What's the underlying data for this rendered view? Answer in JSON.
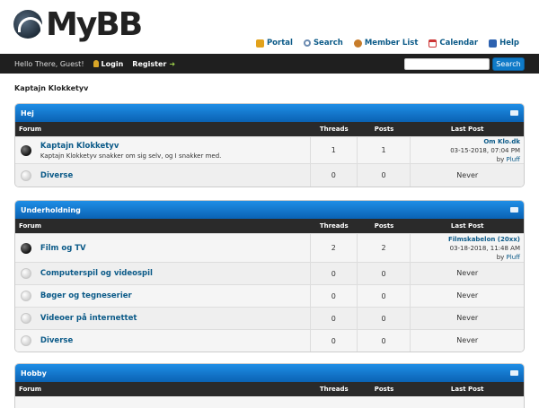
{
  "header": {
    "logo_text": "MyBB",
    "links": [
      {
        "label": "Portal",
        "icon": "portal-icon"
      },
      {
        "label": "Search",
        "icon": "search-icon"
      },
      {
        "label": "Member List",
        "icon": "members-icon"
      },
      {
        "label": "Calendar",
        "icon": "calendar-icon"
      },
      {
        "label": "Help",
        "icon": "help-icon"
      }
    ]
  },
  "panel": {
    "welcome": "Hello There, Guest!",
    "login": "Login",
    "register": "Register",
    "search_button": "Search"
  },
  "breadcrumb": "Kaptajn Klokketyv",
  "columns": {
    "forum": "Forum",
    "threads": "Threads",
    "posts": "Posts",
    "last_post": "Last Post"
  },
  "categories": [
    {
      "title": "Hej",
      "forums": [
        {
          "name": "Kaptajn Klokketyv",
          "desc": "Kaptajn Klokketyv snakker om sig selv, og I snakker med.",
          "status": "on",
          "threads": "1",
          "posts": "1",
          "last": {
            "title": "Om Klo.dk",
            "date": "03-15-2018, 07:04 PM",
            "by": "by",
            "user": "Pluff"
          }
        },
        {
          "name": "Diverse",
          "desc": "",
          "status": "off",
          "threads": "0",
          "posts": "0",
          "never": "Never"
        }
      ]
    },
    {
      "title": "Underholdning",
      "forums": [
        {
          "name": "Film og TV",
          "desc": "",
          "status": "on",
          "threads": "2",
          "posts": "2",
          "last": {
            "title": "Filmskabelon (20xx)",
            "date": "03-18-2018, 11:48 AM",
            "by": "by",
            "user": "Pluff"
          }
        },
        {
          "name": "Computerspil og videospil",
          "desc": "",
          "status": "off",
          "threads": "0",
          "posts": "0",
          "never": "Never"
        },
        {
          "name": "Bøger og tegneserier",
          "desc": "",
          "status": "off",
          "threads": "0",
          "posts": "0",
          "never": "Never"
        },
        {
          "name": "Videoer på internettet",
          "desc": "",
          "status": "off",
          "threads": "0",
          "posts": "0",
          "never": "Never"
        },
        {
          "name": "Diverse",
          "desc": "",
          "status": "off",
          "threads": "0",
          "posts": "0",
          "never": "Never"
        }
      ]
    },
    {
      "title": "Hobby",
      "forums": []
    }
  ]
}
